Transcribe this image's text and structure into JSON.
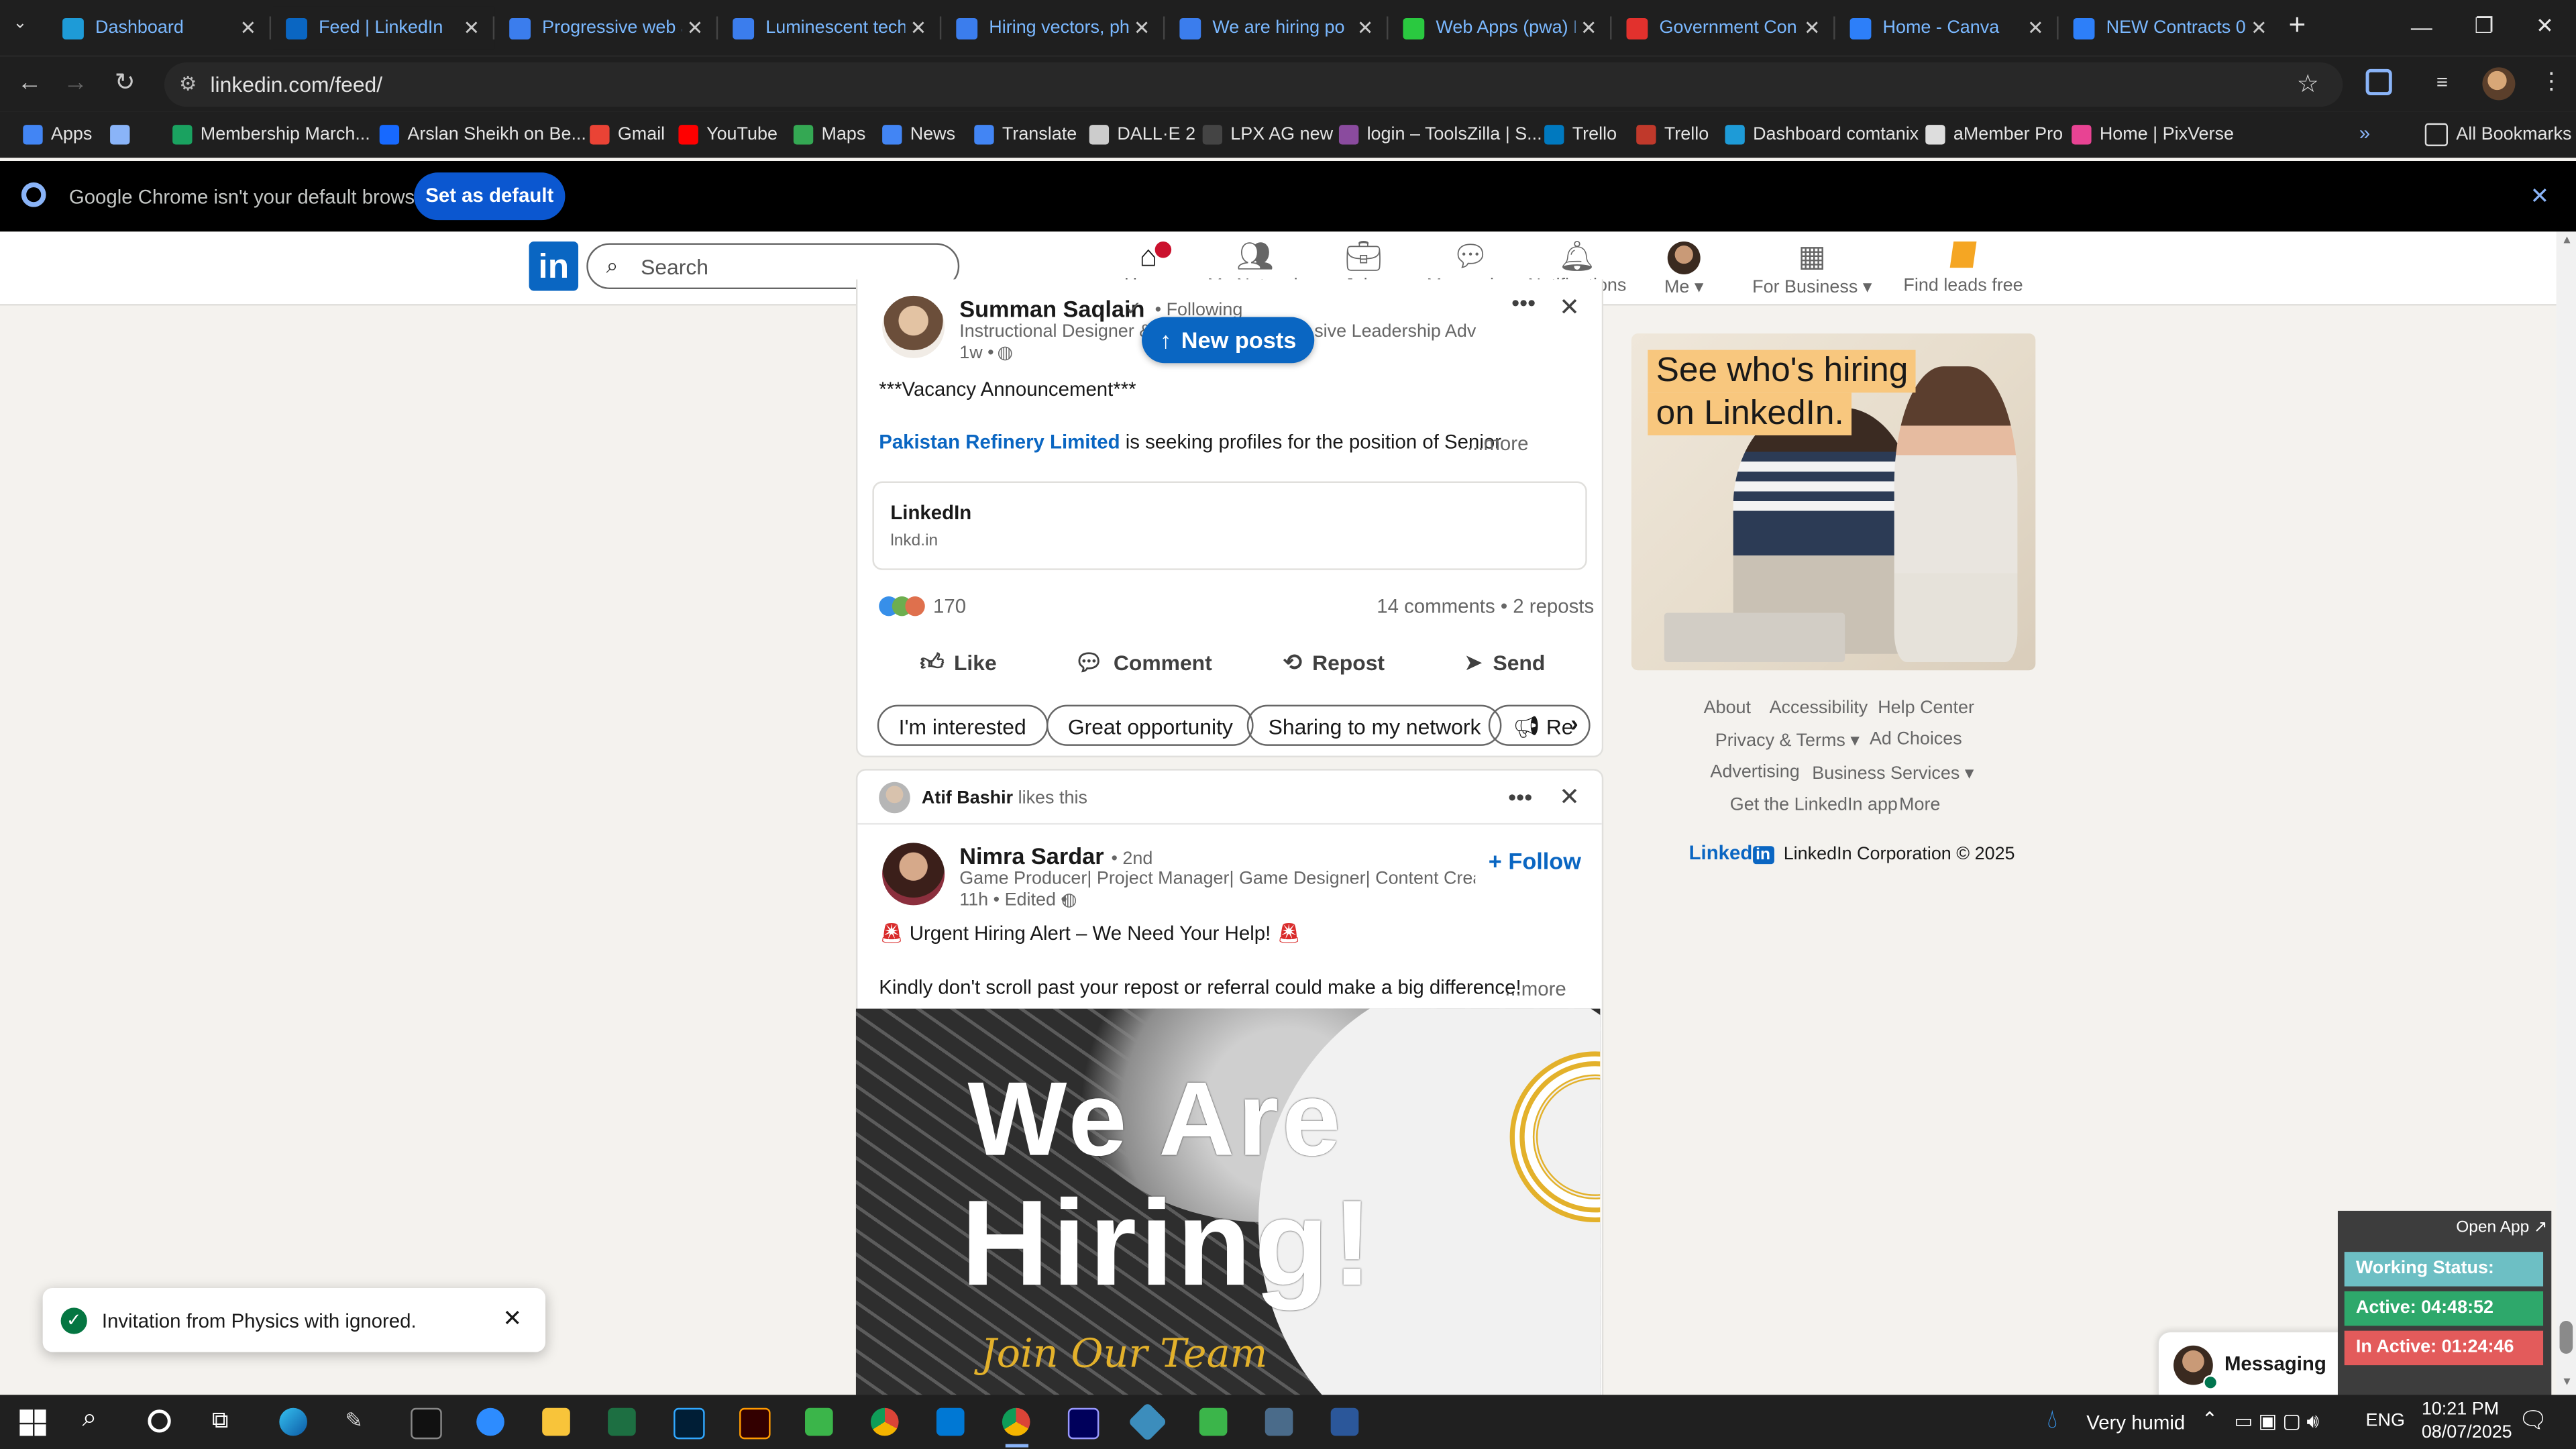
{
  "browser": {
    "tabs": [
      {
        "label": "Dashboard",
        "favicon_color": "#1e9bd7",
        "active": false
      },
      {
        "label": "Feed | LinkedIn",
        "favicon_color": "#0a66c2",
        "active": true
      },
      {
        "label": "Progressive web a",
        "favicon_color": "#3b7ded",
        "active": false
      },
      {
        "label": "Luminescent tech",
        "favicon_color": "#3b7ded",
        "active": false
      },
      {
        "label": "Hiring vectors, ph",
        "favicon_color": "#3b7ded",
        "active": false
      },
      {
        "label": "We are hiring po",
        "favicon_color": "#3b7ded",
        "active": false
      },
      {
        "label": "Web Apps (pwa) I",
        "favicon_color": "#2ac940",
        "active": false
      },
      {
        "label": "Government Con",
        "favicon_color": "#e2312d",
        "active": false
      },
      {
        "label": "Home - Canva",
        "favicon_color": "#2d7ff9",
        "active": false
      },
      {
        "label": "NEW Contracts 0",
        "favicon_color": "#2d7ff9",
        "active": false
      }
    ],
    "url": "linkedin.com/feed/",
    "bookmarks": [
      {
        "label": "Apps",
        "color": "#4285f4"
      },
      {
        "label": "",
        "color": "#8ab4f8"
      },
      {
        "label": "Membership March...",
        "color": "#1aa260"
      },
      {
        "label": "Arslan Sheikh on Be...",
        "color": "#1769ff"
      },
      {
        "label": "Gmail",
        "color": "#ea4335"
      },
      {
        "label": "YouTube",
        "color": "#ff0000"
      },
      {
        "label": "Maps",
        "color": "#34a853"
      },
      {
        "label": "News",
        "color": "#4285f4"
      },
      {
        "label": "Translate",
        "color": "#4285f4"
      },
      {
        "label": "DALL·E 2",
        "color": "#cccccc"
      },
      {
        "label": "LPX AG new",
        "color": "#444444"
      },
      {
        "label": "login – ToolsZilla | S...",
        "color": "#8a4b9e"
      },
      {
        "label": "Trello",
        "color": "#0079bf"
      },
      {
        "label": "Trello",
        "color": "#c0392b"
      },
      {
        "label": "Dashboard comtanix",
        "color": "#1e9bd7"
      },
      {
        "label": "aMember Pro",
        "color": "#dddddd"
      },
      {
        "label": "Home | PixVerse",
        "color": "#e84393"
      }
    ],
    "all_bookmarks": "All Bookmarks",
    "infobar_message": "Google Chrome isn't your default browser",
    "set_default_label": "Set as default"
  },
  "linkedin": {
    "search_placeholder": "Search",
    "nav": [
      {
        "label": "Home",
        "icon": "home-icon"
      },
      {
        "label": "My Network",
        "icon": "network-icon"
      },
      {
        "label": "Jobs",
        "icon": "briefcase-icon"
      },
      {
        "label": "Messaging",
        "icon": "chat-icon"
      },
      {
        "label": "Notifications",
        "icon": "bell-icon"
      },
      {
        "label": "Me",
        "icon": "avatar"
      },
      {
        "label": "For Business",
        "icon": "grid-icon"
      },
      {
        "label": "Find leads free",
        "icon": "leads-icon"
      }
    ],
    "new_posts_label": "New posts",
    "post1": {
      "author": "Summan Saqlain",
      "follow_state": "• Following",
      "headline": "Instructional Designer & L",
      "headline_tail": "sive Leadership Adv",
      "meta": "1w •",
      "text_line1": "***Vacancy Announcement***",
      "company_link": "Pakistan Refinery Limited",
      "text_line2": " is seeking profiles for the position of Senior",
      "more": "...more",
      "link_title": "LinkedIn",
      "link_domain": "lnkd.in",
      "reactions_count": "170",
      "comments_reposts": "14 comments • 2 reposts",
      "actions": [
        "Like",
        "Comment",
        "Repost",
        "Send"
      ],
      "quick_replies": [
        "I'm interested",
        "Great opportunity",
        "Sharing to my network",
        "Re"
      ]
    },
    "post2": {
      "liker": "Atif Bashir",
      "liker_suffix": "likes this",
      "author": "Nimra Sardar",
      "degree": "• 2nd",
      "headline": "Game Producer| Project Manager| Game Designer| Content Creator |Ra...",
      "meta": "11h • Edited •",
      "follow_label": "Follow",
      "text_line1": "Urgent Hiring Alert – We Need Your Help!",
      "text_line2": "Kindly don't scroll past your repost or referral could make a big difference!",
      "more": "...more",
      "image_title_line1": "We Are",
      "image_title_line2": "Hiring!",
      "image_subtitle": "Join Our Team"
    },
    "ad": {
      "headline_line1": "See who's hiring",
      "headline_line2": "on LinkedIn."
    },
    "footer": {
      "row1": [
        "About",
        "Accessibility",
        "Help Center"
      ],
      "row2": [
        "Privacy & Terms",
        "Ad Choices"
      ],
      "row3": [
        "Advertising",
        "Business Services"
      ],
      "row4": [
        "Get the LinkedIn app",
        "More"
      ],
      "brand": "Linked",
      "copyright": "LinkedIn Corporation © 2025"
    },
    "messaging_label": "Messaging"
  },
  "toast": {
    "message": "Invitation from Physics with ignored."
  },
  "tracker_widget": {
    "open_app": "Open App ↗",
    "working_status": "Working Status: Active",
    "active": "Active: 04:48:52",
    "inactive": "In Active: 01:24:46",
    "colors": {
      "status": "#6dbfc4",
      "active": "#2ea86b",
      "inactive": "#e35b5b"
    }
  },
  "taskbar": {
    "weather": "Very humid",
    "language": "ENG",
    "time": "10:21 PM",
    "date": "08/07/2025"
  }
}
